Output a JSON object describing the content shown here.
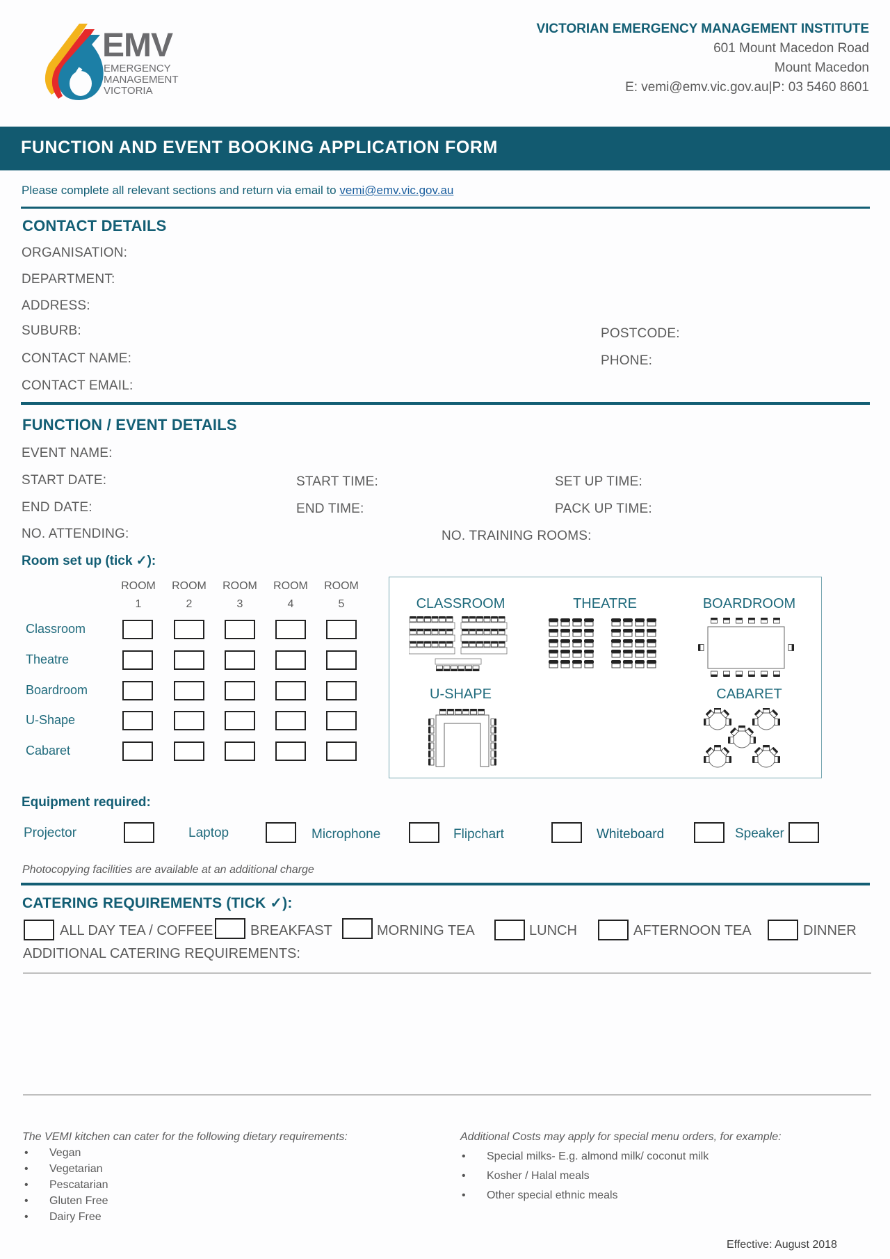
{
  "header": {
    "logo": {
      "mark": "EMV",
      "lines": [
        "EMERGENCY",
        "MANAGEMENT",
        "VICTORIA"
      ]
    },
    "institute": "VICTORIAN EMERGENCY MANAGEMENT INSTITUTE",
    "address_line1": "601 Mount Macedon Road",
    "address_line2": "Mount Macedon",
    "contact_line": "E: vemi@emv.vic.gov.au|P: 03 5460 8601"
  },
  "banner": {
    "title": "FUNCTION AND EVENT BOOKING APPLICATION FORM"
  },
  "intro": {
    "text": "Please complete all relevant sections and return via email to ",
    "email": "vemi@emv.vic.gov.au"
  },
  "contact": {
    "title": "CONTACT DETAILS",
    "organisation": "ORGANISATION:",
    "department": "DEPARTMENT:",
    "address": "ADDRESS:",
    "suburb": "SUBURB:",
    "postcode": "POSTCODE:",
    "contact_name": "CONTACT NAME:",
    "phone": "PHONE:",
    "contact_email": "CONTACT EMAIL:"
  },
  "event": {
    "title": "FUNCTION / EVENT DETAILS",
    "event_name": "EVENT NAME:",
    "start_date": "START DATE:",
    "start_time": "START TIME:",
    "setup_time": "SET UP TIME:",
    "end_date": "END DATE:",
    "end_time": "END TIME:",
    "packup_time": "PACK UP TIME:",
    "attending": "NO. ATTENDING:",
    "training_rooms": "NO. TRAINING ROOMS:",
    "room_setup_title": "Room set up (tick ✓):"
  },
  "room_grid": {
    "rooms": [
      {
        "top": "ROOM",
        "num": "1"
      },
      {
        "top": "ROOM",
        "num": "2"
      },
      {
        "top": "ROOM",
        "num": "3"
      },
      {
        "top": "ROOM",
        "num": "4"
      },
      {
        "top": "ROOM",
        "num": "5"
      }
    ],
    "setups": [
      "Classroom",
      "Theatre",
      "Boardroom",
      "U-Shape",
      "Cabaret"
    ]
  },
  "layouts": {
    "classroom": "CLASSROOM",
    "theatre": "THEATRE",
    "boardroom": "BOARDROOM",
    "ushape": "U-SHAPE",
    "cabaret": "CABARET"
  },
  "equipment": {
    "title": "Equipment required:",
    "items": [
      "Projector",
      "Laptop",
      "Microphone",
      "Flipchart",
      "Whiteboard",
      "Speaker"
    ],
    "note": "Photocopying facilities are available at an additional charge"
  },
  "catering": {
    "title": "CATERING REQUIREMENTS (TICK ✓):",
    "items": [
      "ALL DAY TEA / COFFEE",
      "BREAKFAST",
      "MORNING TEA",
      "LUNCH",
      "AFTERNOON TEA",
      "DINNER"
    ],
    "additional": "ADDITIONAL CATERING REQUIREMENTS:"
  },
  "dietary": {
    "intro": "The VEMI kitchen can cater for the following dietary requirements:",
    "items": [
      "Vegan",
      "Vegetarian",
      "Pescatarian",
      "Gluten Free",
      "Dairy Free"
    ]
  },
  "costs": {
    "intro": "Additional Costs may apply for special menu orders, for example:",
    "items": [
      "Special milks- E.g. almond milk/ coconut milk",
      "Kosher / Halal meals",
      "Other special ethnic meals"
    ]
  },
  "footer": {
    "effective": "Effective: August 2018"
  },
  "colors": {
    "brand_teal": "#125a70",
    "text_gray": "#5b5b5b"
  }
}
